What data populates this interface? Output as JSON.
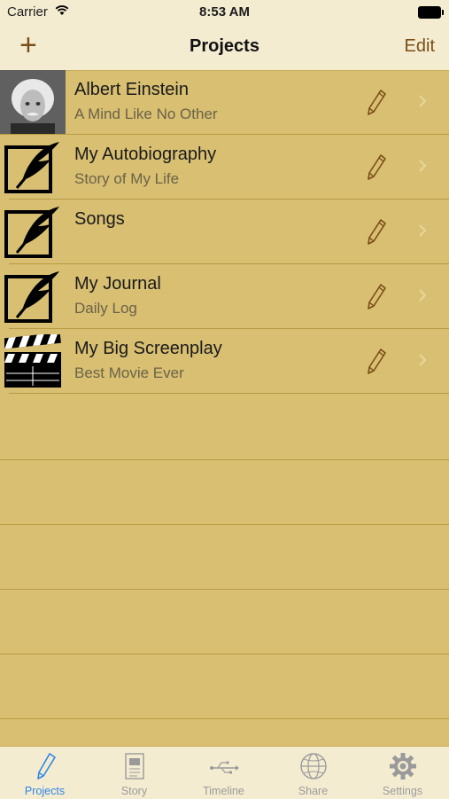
{
  "status_bar": {
    "carrier": "Carrier",
    "time": "8:53 AM"
  },
  "nav": {
    "add_label": "+",
    "title": "Projects",
    "edit_label": "Edit"
  },
  "projects": [
    {
      "title": "Albert Einstein",
      "subtitle": "A Mind Like No Other",
      "thumb": "portrait-photo"
    },
    {
      "title": "My Autobiography",
      "subtitle": "Story of My Life",
      "thumb": "quill-icon"
    },
    {
      "title": "Songs",
      "subtitle": "",
      "thumb": "quill-icon"
    },
    {
      "title": "My Journal",
      "subtitle": "Daily Log",
      "thumb": "quill-icon"
    },
    {
      "title": "My Big Screenplay",
      "subtitle": "Best Movie Ever",
      "thumb": "clapperboard-icon"
    }
  ],
  "tabs": [
    {
      "label": "Projects",
      "icon": "pencil-icon",
      "active": true
    },
    {
      "label": "Story",
      "icon": "document-icon",
      "active": false
    },
    {
      "label": "Timeline",
      "icon": "usb-icon",
      "active": false
    },
    {
      "label": "Share",
      "icon": "globe-icon",
      "active": false
    },
    {
      "label": "Settings",
      "icon": "gear-icon",
      "active": false
    }
  ],
  "colors": {
    "accent": "#7a4d17",
    "tab_active": "#2f86e6",
    "paper": "#d8bf72",
    "bar": "#f4ecd1"
  }
}
